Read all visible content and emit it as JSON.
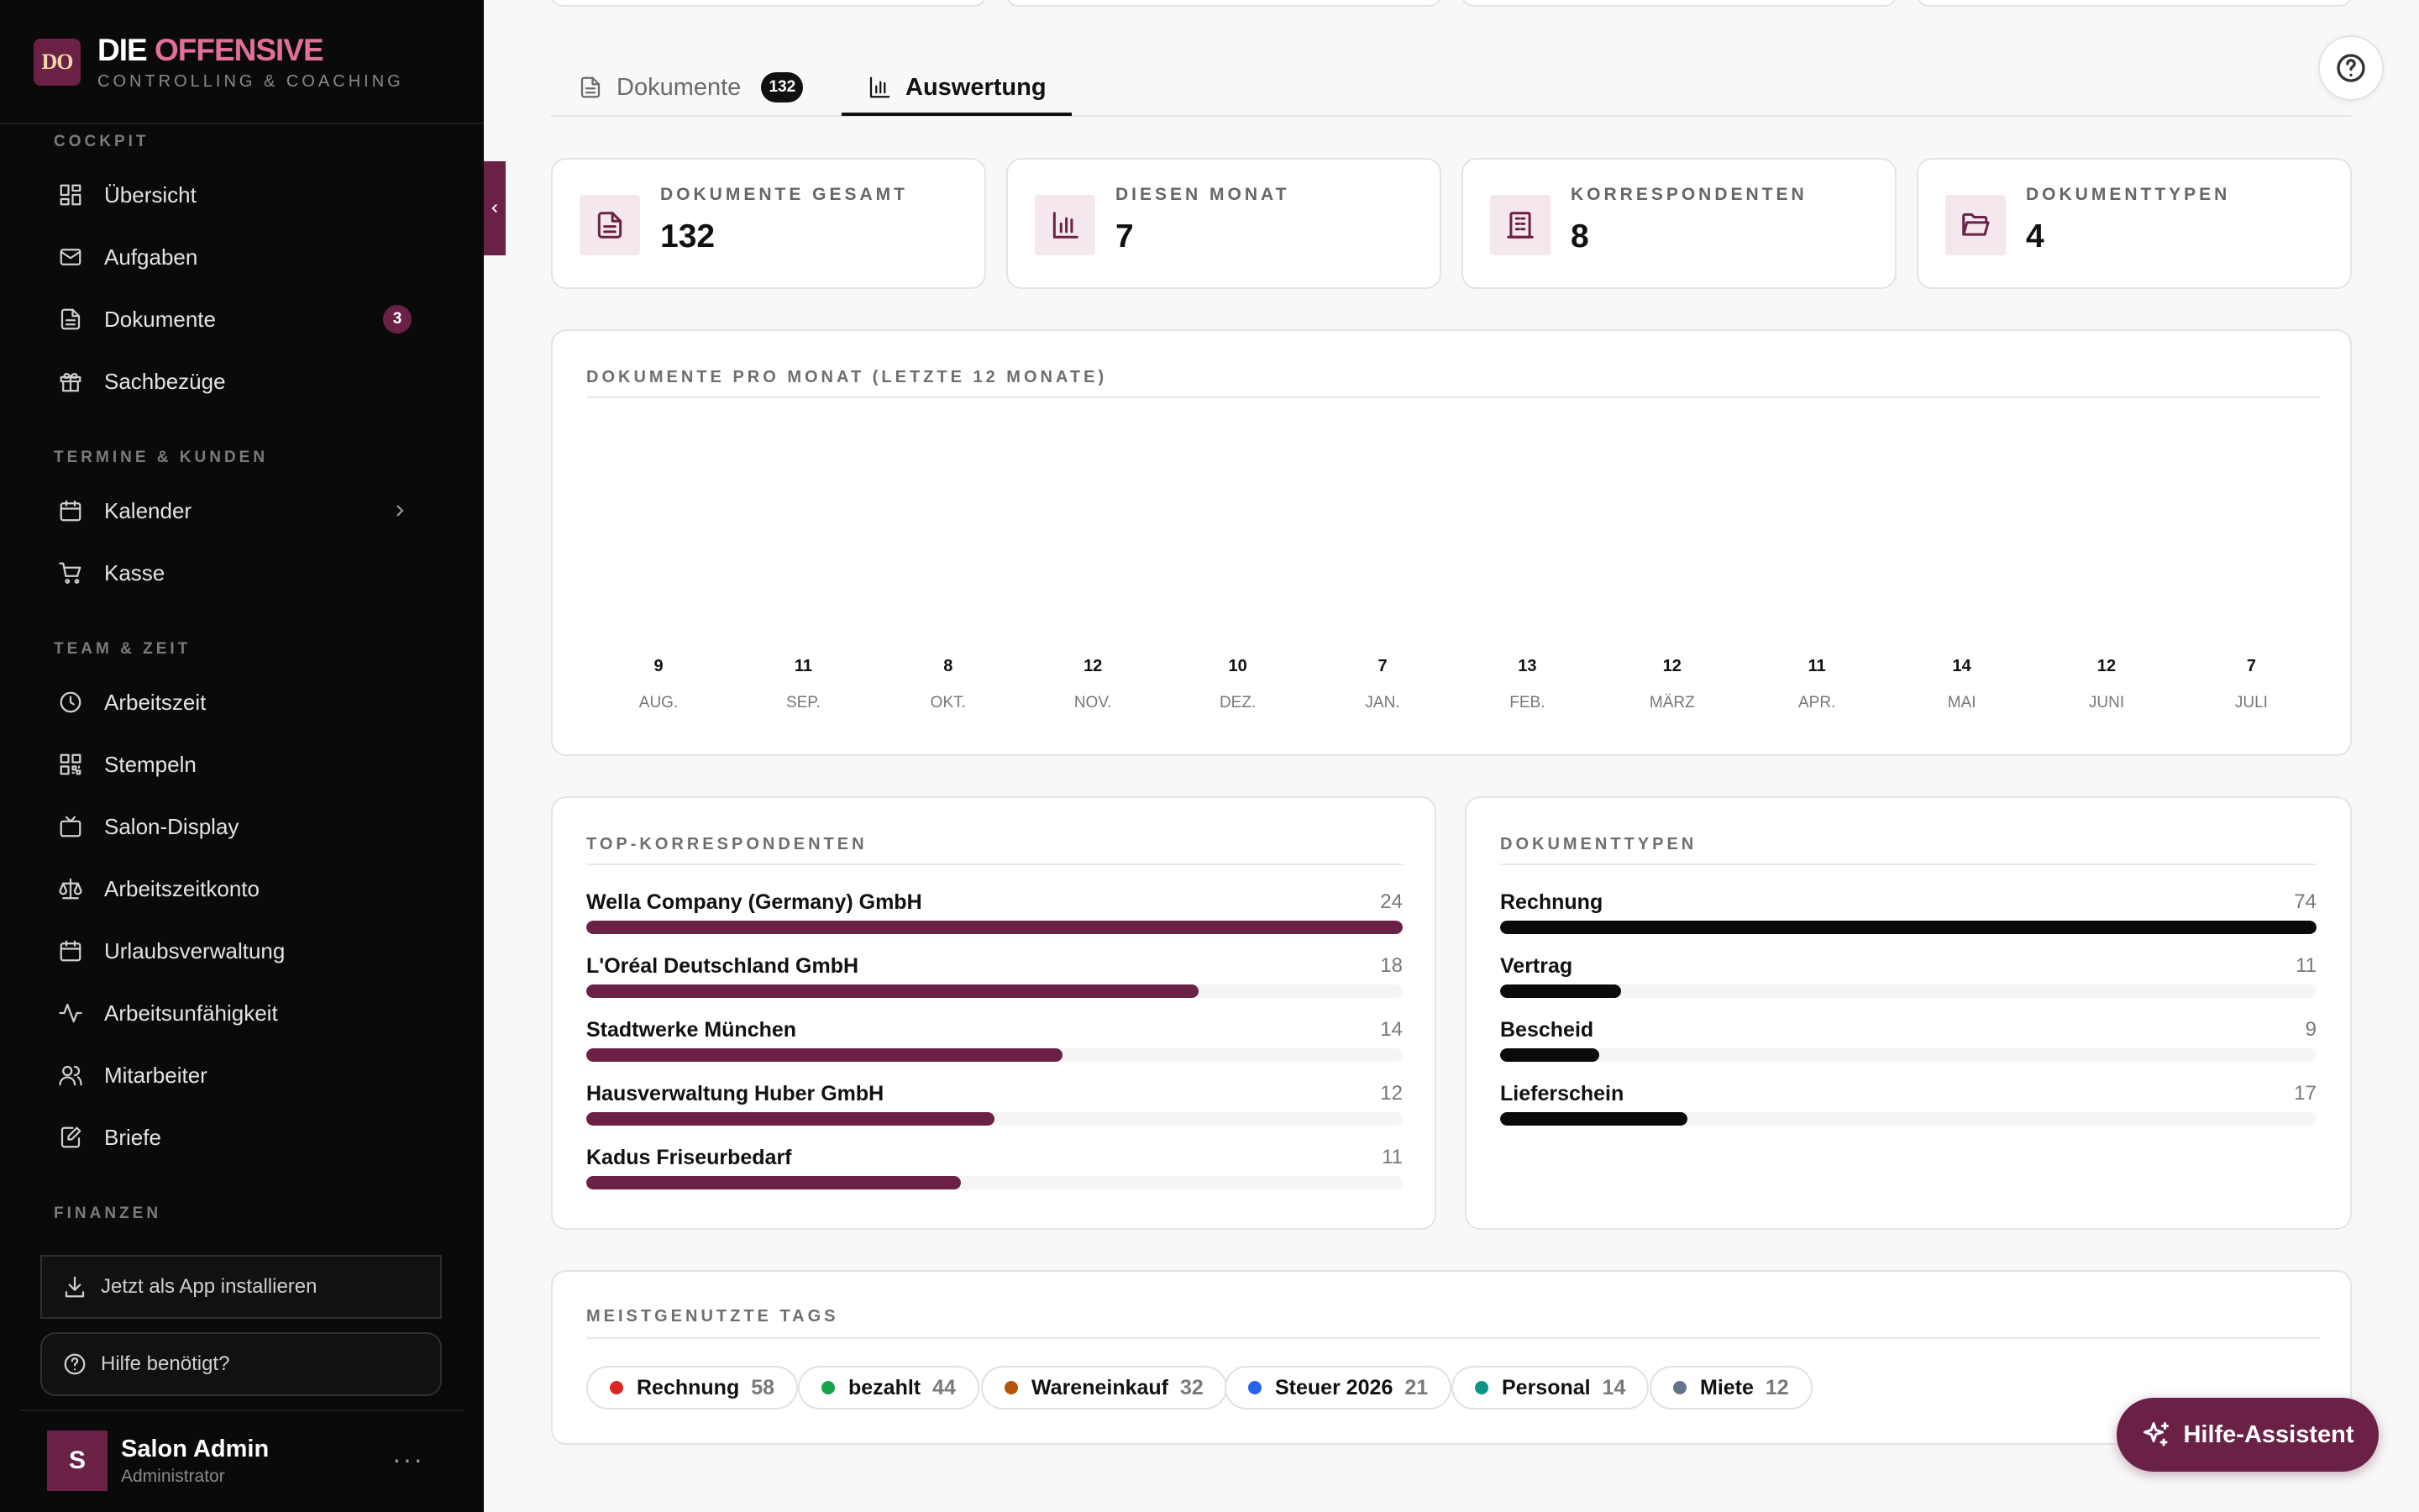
{
  "brand": {
    "logo_text": "DO",
    "title_part1": "DIE",
    "title_part2": "OFFENSIVE",
    "subtitle": "CONTROLLING & COACHING"
  },
  "sidebar": {
    "sections": [
      {
        "label": "COCKPIT",
        "items": [
          {
            "label": "Übersicht",
            "icon": "dashboard-icon"
          },
          {
            "label": "Aufgaben",
            "icon": "mail-icon"
          },
          {
            "label": "Dokumente",
            "icon": "document-icon",
            "badge": "3"
          },
          {
            "label": "Sachbezüge",
            "icon": "gift-icon"
          }
        ]
      },
      {
        "label": "TERMINE & KUNDEN",
        "items": [
          {
            "label": "Kalender",
            "icon": "calendar-icon"
          },
          {
            "label": "Kasse",
            "icon": "cart-icon"
          }
        ]
      },
      {
        "label": "TEAM & ZEIT",
        "items": [
          {
            "label": "Arbeitszeit",
            "icon": "clock-icon"
          },
          {
            "label": "Stempeln",
            "icon": "qr-code-icon"
          },
          {
            "label": "Salon-Display",
            "icon": "tv-icon"
          },
          {
            "label": "Arbeitszeitkonto",
            "icon": "scale-icon"
          },
          {
            "label": "Urlaubsverwaltung",
            "icon": "calendar-icon"
          },
          {
            "label": "Arbeitsunfähigkeit",
            "icon": "activity-icon"
          },
          {
            "label": "Mitarbeiter",
            "icon": "users-icon"
          },
          {
            "label": "Briefe",
            "icon": "edit-document-icon"
          }
        ]
      },
      {
        "label": "FINANZEN",
        "items": []
      }
    ],
    "install_label": "Jetzt als App installieren",
    "help_label": "Hilfe benötigt?",
    "user": {
      "initial": "S",
      "name": "Salon Admin",
      "role": "Administrator",
      "more": "···"
    }
  },
  "tabs": [
    {
      "label": "Dokumente",
      "count": "132",
      "active": false
    },
    {
      "label": "Auswertung",
      "active": true
    }
  ],
  "stats": [
    {
      "label": "DOKUMENTE GESAMT",
      "value": "132",
      "icon": "document-icon"
    },
    {
      "label": "DIESEN MONAT",
      "value": "7",
      "icon": "bar-chart-icon"
    },
    {
      "label": "KORRESPONDENTEN",
      "value": "8",
      "icon": "building-icon"
    },
    {
      "label": "DOKUMENTTYPEN",
      "value": "4",
      "icon": "folder-open-icon"
    }
  ],
  "monthly": {
    "title": "DOKUMENTE PRO MONAT (LETZTE 12 MONATE)",
    "months": [
      {
        "label": "AUG.",
        "value": 9
      },
      {
        "label": "SEP.",
        "value": 11
      },
      {
        "label": "OKT.",
        "value": 8
      },
      {
        "label": "NOV.",
        "value": 12
      },
      {
        "label": "DEZ.",
        "value": 10
      },
      {
        "label": "JAN.",
        "value": 7
      },
      {
        "label": "FEB.",
        "value": 13
      },
      {
        "label": "MÄRZ",
        "value": 12
      },
      {
        "label": "APR.",
        "value": 11
      },
      {
        "label": "MAI",
        "value": 14
      },
      {
        "label": "JUNI",
        "value": 12
      },
      {
        "label": "JULI",
        "value": 7
      }
    ]
  },
  "correspondents": {
    "title": "TOP-KORRESPONDENTEN",
    "max": 24,
    "color": "#6b2146",
    "rows": [
      {
        "name": "Wella Company (Germany) GmbH",
        "count": 24
      },
      {
        "name": "L'Oréal Deutschland GmbH",
        "count": 18
      },
      {
        "name": "Stadtwerke München",
        "count": 14
      },
      {
        "name": "Hausverwaltung Huber GmbH",
        "count": 12
      },
      {
        "name": "Kadus Friseurbedarf",
        "count": 11
      }
    ]
  },
  "doctypes": {
    "title": "DOKUMENTTYPEN",
    "max": 74,
    "color": "#0a0a0a",
    "rows": [
      {
        "name": "Rechnung",
        "count": 74
      },
      {
        "name": "Vertrag",
        "count": 11
      },
      {
        "name": "Bescheid",
        "count": 9
      },
      {
        "name": "Lieferschein",
        "count": 17
      }
    ]
  },
  "tags": {
    "title": "MEISTGENUTZTE TAGS",
    "items": [
      {
        "name": "Rechnung",
        "count": "58",
        "color": "#dc2626"
      },
      {
        "name": "bezahlt",
        "count": "44",
        "color": "#16a34a"
      },
      {
        "name": "Wareneinkauf",
        "count": "32",
        "color": "#b45309"
      },
      {
        "name": "Steuer 2026",
        "count": "21",
        "color": "#2563eb"
      },
      {
        "name": "Personal",
        "count": "14",
        "color": "#0d9488"
      },
      {
        "name": "Miete",
        "count": "12",
        "color": "#64748b"
      }
    ]
  },
  "assistant": {
    "label": "Hilfe-Assistent"
  }
}
